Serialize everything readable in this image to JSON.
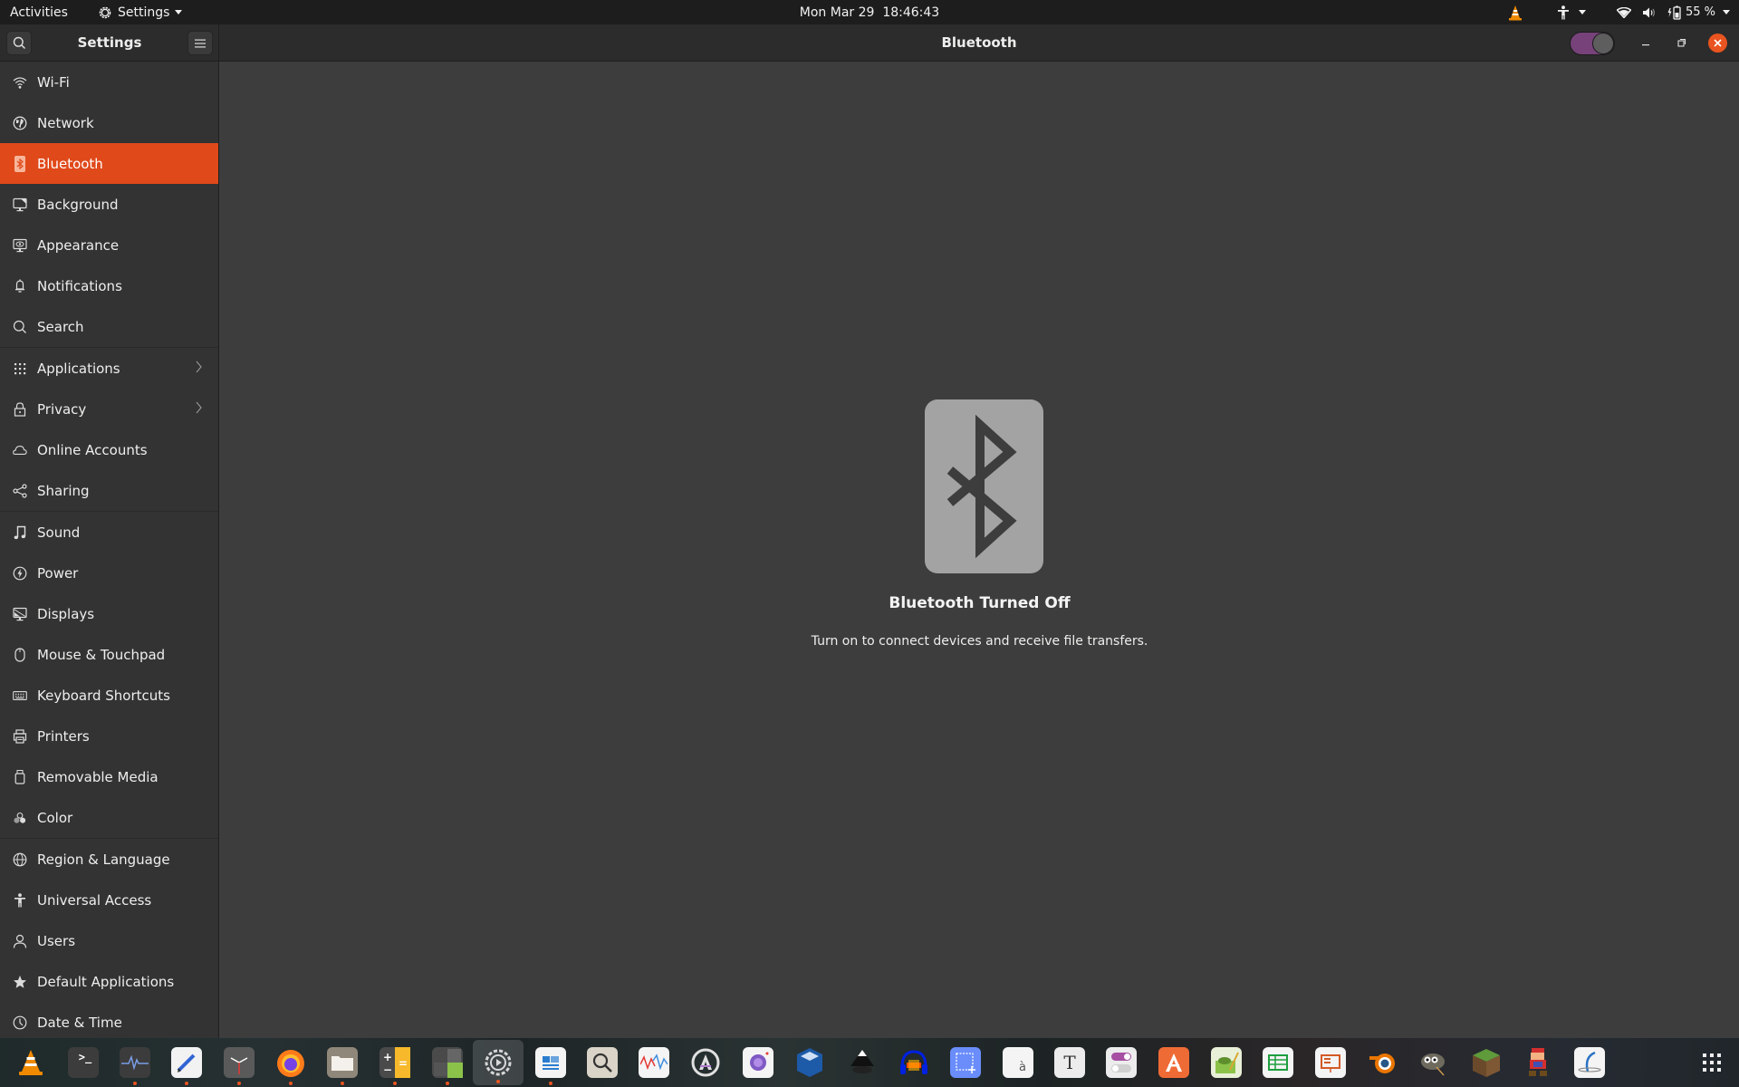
{
  "topbar": {
    "activities": "Activities",
    "app_menu": "Settings",
    "clock": "Mon Mar 29  18:46:43",
    "battery": "55 %"
  },
  "headerbar": {
    "sidebar_title": "Settings",
    "page_title": "Bluetooth",
    "bluetooth_enabled": false
  },
  "sidebar": {
    "items": [
      {
        "label": "Wi-Fi",
        "icon": "wifi-icon"
      },
      {
        "label": "Network",
        "icon": "network-icon"
      },
      {
        "label": "Bluetooth",
        "icon": "bluetooth-icon",
        "active": true
      },
      {
        "label": "Background",
        "icon": "background-icon"
      },
      {
        "label": "Appearance",
        "icon": "appearance-icon"
      },
      {
        "label": "Notifications",
        "icon": "bell-icon"
      },
      {
        "label": "Search",
        "icon": "search-icon"
      },
      {
        "label": "Applications",
        "icon": "apps-grid-icon",
        "chevron": true
      },
      {
        "label": "Privacy",
        "icon": "lock-icon",
        "chevron": true
      },
      {
        "label": "Online Accounts",
        "icon": "cloud-icon"
      },
      {
        "label": "Sharing",
        "icon": "share-icon"
      },
      {
        "label": "Sound",
        "icon": "music-note-icon"
      },
      {
        "label": "Power",
        "icon": "power-icon"
      },
      {
        "label": "Displays",
        "icon": "display-icon"
      },
      {
        "label": "Mouse & Touchpad",
        "icon": "mouse-icon"
      },
      {
        "label": "Keyboard Shortcuts",
        "icon": "keyboard-icon"
      },
      {
        "label": "Printers",
        "icon": "printer-icon"
      },
      {
        "label": "Removable Media",
        "icon": "usb-drive-icon"
      },
      {
        "label": "Color",
        "icon": "color-icon"
      },
      {
        "label": "Region & Language",
        "icon": "globe-icon"
      },
      {
        "label": "Universal Access",
        "icon": "accessibility-icon"
      },
      {
        "label": "Users",
        "icon": "user-icon"
      },
      {
        "label": "Default Applications",
        "icon": "star-icon"
      },
      {
        "label": "Date & Time",
        "icon": "clock-icon"
      }
    ]
  },
  "main": {
    "status_title": "Bluetooth Turned Off",
    "status_description": "Turn on to connect devices and receive file transfers."
  },
  "dock": {
    "apps": [
      {
        "name": "vlc",
        "running": false
      },
      {
        "name": "terminal",
        "running": false
      },
      {
        "name": "system-monitor",
        "running": true
      },
      {
        "name": "text-editor",
        "running": true
      },
      {
        "name": "clocks",
        "running": true
      },
      {
        "name": "firefox",
        "running": true
      },
      {
        "name": "files",
        "running": true
      },
      {
        "name": "calculator",
        "running": true
      },
      {
        "name": "extensions",
        "running": true
      },
      {
        "name": "settings",
        "running": true,
        "focused": true
      },
      {
        "name": "libreoffice-writer",
        "running": true
      },
      {
        "name": "image-viewer",
        "running": false
      },
      {
        "name": "sound-recorder",
        "running": false
      },
      {
        "name": "software-updater",
        "running": false
      },
      {
        "name": "cheese-webcam",
        "running": false
      },
      {
        "name": "virtualbox",
        "running": false
      },
      {
        "name": "inkscape",
        "running": false
      },
      {
        "name": "audacity",
        "running": false
      },
      {
        "name": "screenshot",
        "running": false
      },
      {
        "name": "characters",
        "running": false
      },
      {
        "name": "fonts",
        "running": false
      },
      {
        "name": "tweaks",
        "running": false
      },
      {
        "name": "ubuntu-software",
        "running": false
      },
      {
        "name": "gedit-plugin",
        "running": false
      },
      {
        "name": "libreoffice-calc",
        "running": false
      },
      {
        "name": "libreoffice-impress",
        "running": false
      },
      {
        "name": "blender",
        "running": false
      },
      {
        "name": "gimp",
        "running": false
      },
      {
        "name": "minecraft",
        "running": false
      },
      {
        "name": "mario-game",
        "running": false
      },
      {
        "name": "openshot",
        "running": false
      },
      {
        "name": "show-applications",
        "running": false
      }
    ]
  },
  "colors": {
    "accent": "#e95420",
    "active_row": "#e0491a",
    "switch_off_track": "#77427a"
  }
}
